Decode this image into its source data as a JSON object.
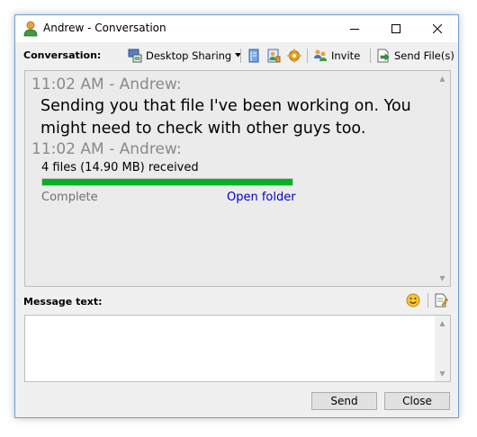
{
  "window": {
    "title": "Andrew - Conversation",
    "icon": "user-icon"
  },
  "toolbar": {
    "conversation_label": "Conversation:",
    "desktop_sharing_label": "Desktop Sharing",
    "invite_label": "Invite",
    "send_files_label": "Send File(s)"
  },
  "conversation": {
    "messages": [
      {
        "header": "11:02 AM - Andrew:",
        "text": "Sending you that file I've been working on. You might need to check with other guys too."
      },
      {
        "header": "11:02 AM - Andrew:"
      }
    ],
    "transfer": {
      "summary": "4 files (14.90 MB) received",
      "progress": 1.0,
      "status": "Complete",
      "open_folder_label": "Open folder",
      "progress_color": "#06b025"
    }
  },
  "compose": {
    "label": "Message text:",
    "value": ""
  },
  "buttons": {
    "send": "Send",
    "close": "Close"
  }
}
